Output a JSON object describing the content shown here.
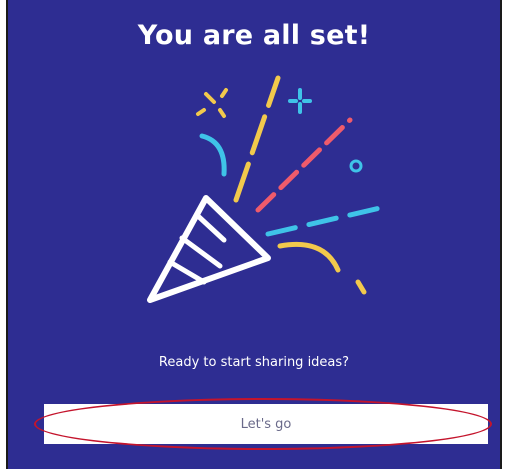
{
  "screen": {
    "title": "You are all set!",
    "subtitle": "Ready to start sharing ideas?",
    "cta_label": "Let's go",
    "illustration_icon": "party-popper-icon"
  },
  "colors": {
    "background": "#2e2d92",
    "title_text": "#ffffff",
    "button_bg": "#ffffff",
    "button_text": "#6a6a8a",
    "highlight_ring": "#c4142c",
    "confetti_yellow": "#f2c94c",
    "confetti_red": "#ef5b6b",
    "confetti_cyan": "#3fc3e8"
  }
}
